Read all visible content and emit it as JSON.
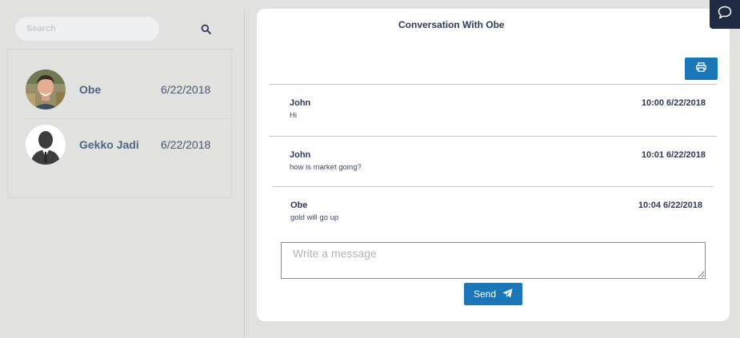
{
  "sidebar": {
    "search": {
      "placeholder": "Search",
      "value": ""
    },
    "contacts": [
      {
        "name": "Obe",
        "date": "6/22/2018",
        "avatar": "photo-avatar"
      },
      {
        "name": "Gekko Jadi",
        "date": "6/22/2018",
        "avatar": "silhouette-avatar"
      }
    ]
  },
  "conversation": {
    "title": "Conversation With Obe",
    "messages": [
      {
        "author": "John",
        "text": "Hi",
        "time": "10:00 6/22/2018"
      },
      {
        "author": "John",
        "text": "how is market going?",
        "time": "10:01 6/22/2018"
      },
      {
        "author": "Obe",
        "text": "gold will go up",
        "time": "10:04 6/22/2018"
      }
    ],
    "input": {
      "placeholder": "Write a message",
      "value": ""
    },
    "send_label": "Send"
  },
  "colors": {
    "accent": "#1b76b8",
    "background": "#e1e1df",
    "chat_toggle": "#1f2a44",
    "contact_name": "#4e6585"
  },
  "icons": [
    "search-icon",
    "print-icon",
    "paper-plane-icon",
    "chat-bubble-icon"
  ]
}
